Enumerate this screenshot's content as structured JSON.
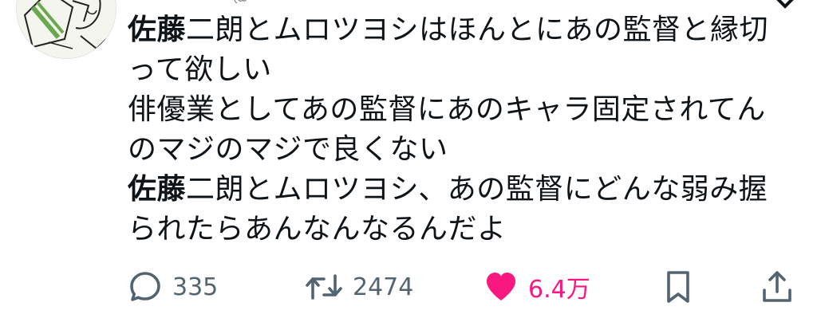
{
  "header": {
    "partial_text": "・ ・ ・ ・ ・ @ ・ ・ ・ ・ ・ ・ ・ ・ ・ ・ ・ ・"
  },
  "tweet": {
    "lines": [
      [
        {
          "t": "佐藤",
          "b": true
        },
        {
          "t": "二朗とムロツヨシはほんとにあの監督と縁切",
          "b": false
        }
      ],
      [
        {
          "t": "って欲しい",
          "b": false
        }
      ],
      [
        {
          "t": "俳優業としてあの監督にあのキャラ固定されてん",
          "b": false
        }
      ],
      [
        {
          "t": "のマジのマジで良くない",
          "b": false
        }
      ],
      [
        {
          "t": "佐藤",
          "b": true
        },
        {
          "t": "二朗とムロツヨシ、あの監督にどんな弱み握",
          "b": false
        }
      ],
      [
        {
          "t": "られたらあんなんなるんだよ",
          "b": false
        }
      ]
    ]
  },
  "actions": {
    "reply_count": "335",
    "retweet_count": "2474",
    "like_count": "6.4万",
    "liked": true
  },
  "icons": {
    "reply": "speech-bubble-icon",
    "retweet": "retweet-arrows-icon",
    "like": "heart-icon",
    "bookmark": "bookmark-icon",
    "share": "share-upload-icon"
  },
  "colors": {
    "text": "#0f1419",
    "muted": "#536471",
    "like": "#f91880"
  }
}
